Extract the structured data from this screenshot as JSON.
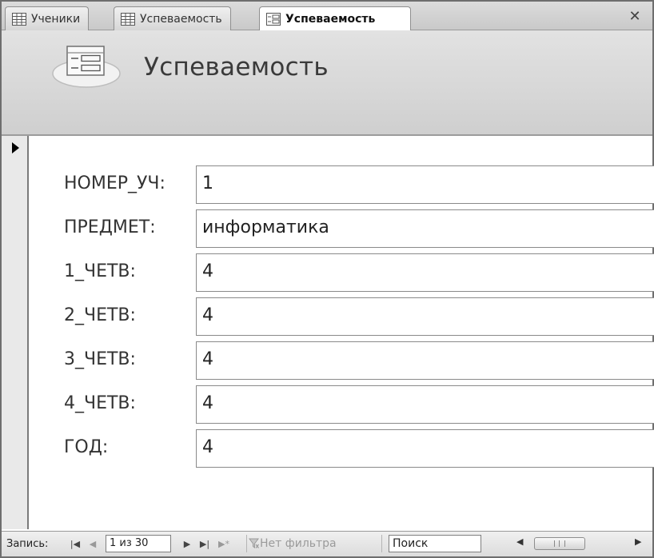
{
  "tabs": [
    {
      "label": "Ученики",
      "icon": "table-icon",
      "active": false
    },
    {
      "label": "Успеваемость",
      "icon": "table-icon",
      "active": false
    },
    {
      "label": "Успеваемость",
      "icon": "form-icon",
      "active": true
    }
  ],
  "header": {
    "title": "Успеваемость",
    "icon": "form-icon"
  },
  "fields": [
    {
      "label": "НОМЕР_УЧ:",
      "value": "1"
    },
    {
      "label": "ПРЕДМЕТ:",
      "value": "информатика"
    },
    {
      "label": "1_ЧЕТВ:",
      "value": "4"
    },
    {
      "label": "2_ЧЕТВ:",
      "value": "4"
    },
    {
      "label": "3_ЧЕТВ:",
      "value": "4"
    },
    {
      "label": "4_ЧЕТВ:",
      "value": "4"
    },
    {
      "label": "ГОД:",
      "value": "4"
    }
  ],
  "navbar": {
    "record_label": "Запись:",
    "record_position": "1 из 30",
    "filter_label": "Нет фильтра",
    "search_placeholder": "Поиск"
  },
  "colors": {
    "header_bg": "#d8d8d8",
    "border": "#8a8a8a"
  }
}
